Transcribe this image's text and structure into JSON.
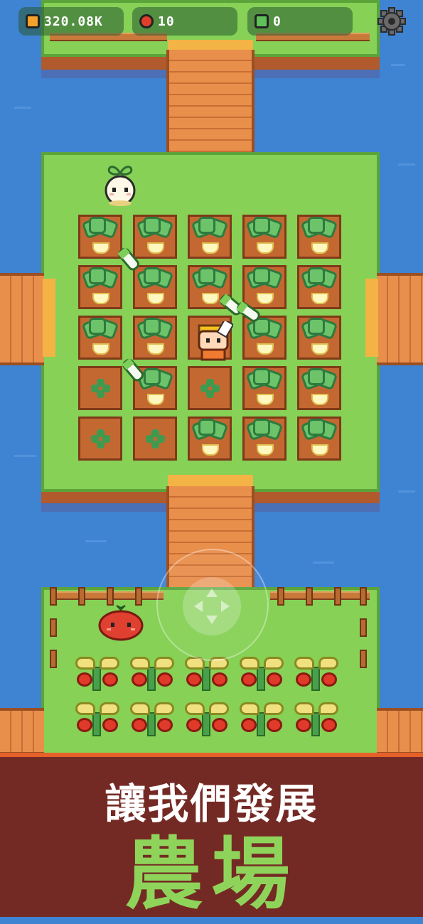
{
  "hud": {
    "coins": {
      "value": "320.08K",
      "icon": "coin-icon",
      "color": "#f3a12a"
    },
    "tomatoes": {
      "value": "10",
      "icon": "tomato-icon",
      "color": "#e0402a"
    },
    "gems": {
      "value": "0",
      "icon": "gem-icon",
      "color": "#5fc05a"
    },
    "settings_icon": "gear-icon"
  },
  "banner": {
    "line1": "讓我們發展",
    "line2": "農場",
    "accent_color": "#8fd45a",
    "background_color": "#742a24"
  },
  "farm": {
    "plot_grid": {
      "rows": [
        [
          "turnip",
          "turnip",
          "turnip",
          "turnip",
          "turnip"
        ],
        [
          "turnip",
          "turnip",
          "turnip",
          "turnip",
          "turnip"
        ],
        [
          "turnip",
          "turnip",
          "empty",
          "turnip",
          "turnip"
        ],
        [
          "sprout",
          "turnip",
          "sprout",
          "turnip",
          "turnip"
        ],
        [
          "sprout",
          "sprout",
          "turnip",
          "turnip",
          "turnip"
        ]
      ]
    },
    "tomato_rows": 2,
    "tomato_cols": 5
  },
  "joystick": {
    "icon": "move-arrows-icon"
  }
}
